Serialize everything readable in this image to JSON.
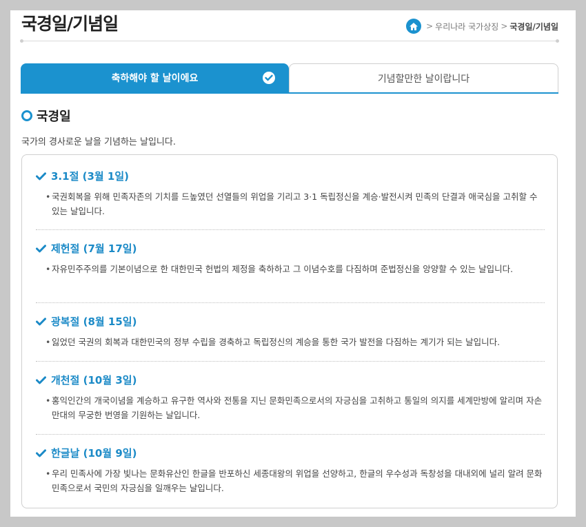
{
  "header": {
    "title": "국경일/기념일",
    "breadcrumb": [
      "우리나라 국가상징",
      "국경일/기념일"
    ]
  },
  "tabs": [
    {
      "label": "축하해야 할 날이에요",
      "active": true
    },
    {
      "label": "기념할만한 날이랍니다",
      "active": false
    }
  ],
  "section": {
    "heading": "국경일",
    "description": "국가의 경사로운 날을 기념하는 날입니다."
  },
  "holidays": [
    {
      "title": "3.1절 (3월 1일)",
      "desc": "국권회복을 위해 민족자존의 기치를 드높였던 선열들의 위업을 기리고 3·1 독립정신을 계승·발전시켜 민족의 단결과 애국심을 고취할 수 있는 날입니다."
    },
    {
      "title": "제헌절 (7월 17일)",
      "desc": "자유민주주의를 기본이념으로 한 대한민국 헌법의 제정을 축하하고 그 이념수호를 다짐하며 준법정신을 앙양할 수 있는 날입니다."
    },
    {
      "title": "광복절 (8월 15일)",
      "desc": "잃었던 국권의 회복과 대한민국의 정부 수립을 경축하고 독립정신의 계승을 통한 국가 발전을 다짐하는 계기가 되는 날입니다."
    },
    {
      "title": "개천절 (10월 3일)",
      "desc": "홍익인간의 개국이념을 계승하고 유구한 역사와 전통을 지닌 문화민족으로서의 자긍심을 고취하고 통일의 의지를 세계만방에 알리며 자손만대의 무궁한 번영을 기원하는 날입니다."
    },
    {
      "title": "한글날 (10월 9일)",
      "desc": "우리 민족사에 가장 빛나는 문화유산인 한글을 반포하신 세종대왕의 위업을 선양하고, 한글의 우수성과 독창성을 대내외에 널리 알려 문화민족으로서 국민의 자긍심을 일깨우는 날입니다."
    }
  ],
  "colors": {
    "accent": "#1b92cf",
    "heading_blue": "#1b8ac7"
  },
  "icons": {
    "home": "home-icon",
    "check": "check-icon",
    "ring": "ring-icon",
    "tab_check": "check-circle-icon"
  }
}
